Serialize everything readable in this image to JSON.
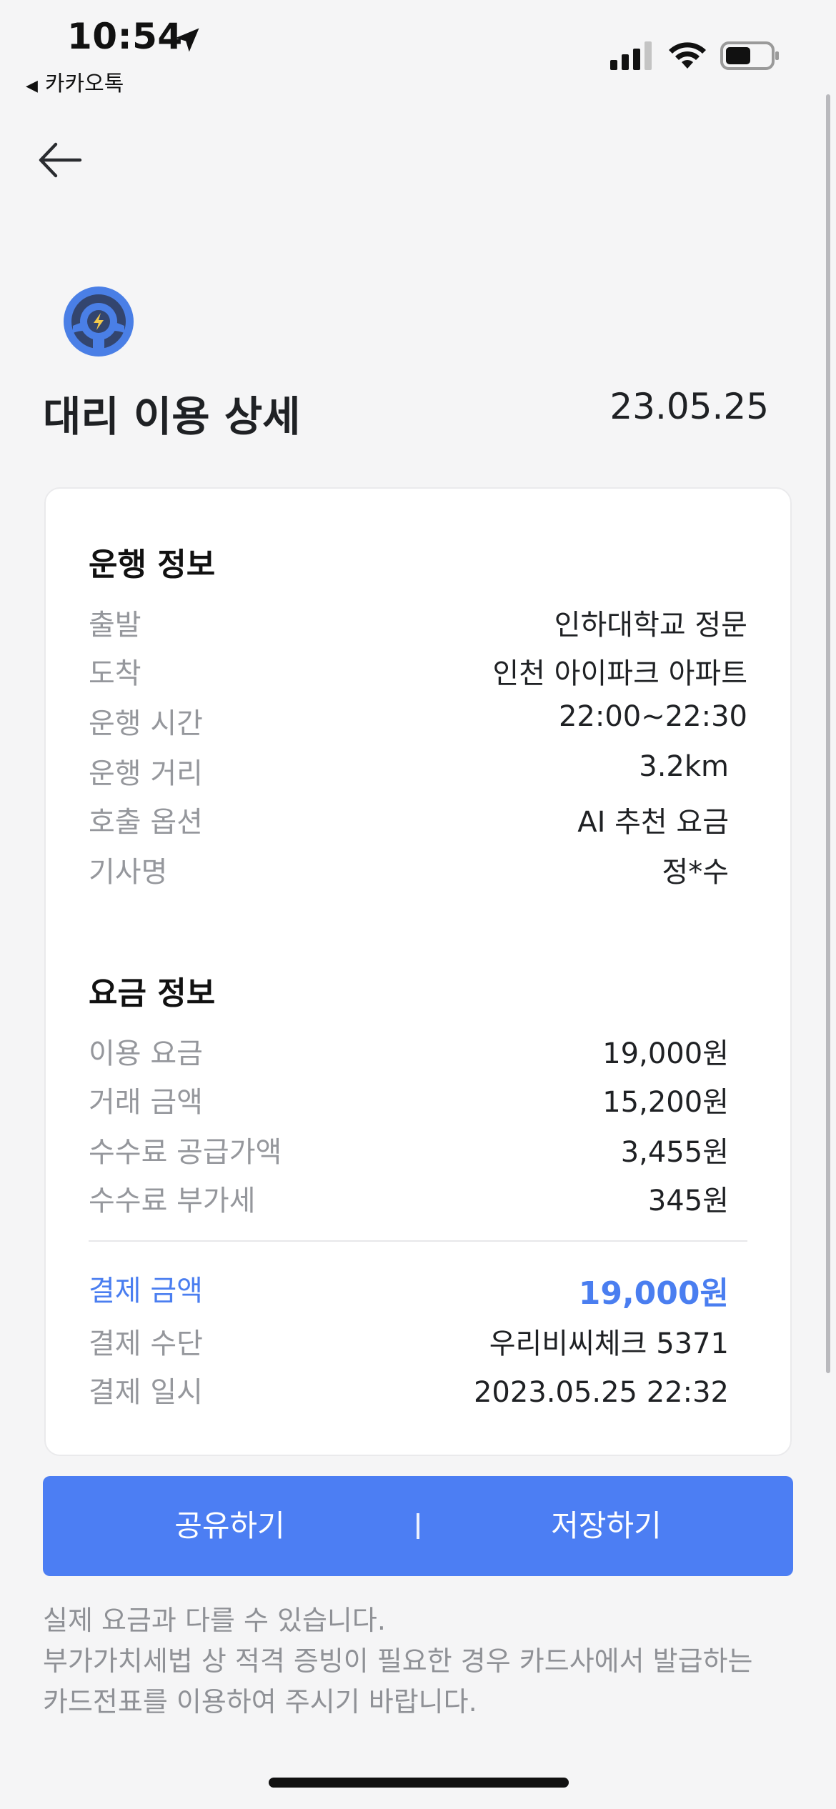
{
  "status_bar": {
    "time": "10:54",
    "back_app_label": "카카오톡"
  },
  "header": {
    "title": "대리 이용 상세",
    "date": "23.05.25"
  },
  "drive_info": {
    "title": "운행 정보",
    "rows": [
      {
        "label": "출발",
        "value": "인하대학교 정문"
      },
      {
        "label": "도착",
        "value": "인천 아이파크 아파트"
      },
      {
        "label": "운행 시간",
        "value": "22:00~22:30"
      },
      {
        "label": "운행 거리",
        "value": "3.2km"
      },
      {
        "label": "호출 옵션",
        "value": "AI 추천 요금"
      },
      {
        "label": "기사명",
        "value": "정*수"
      }
    ]
  },
  "fare_info": {
    "title": "요금 정보",
    "rows": [
      {
        "label": "이용 요금",
        "value": "19,000원"
      },
      {
        "label": "거래 금액",
        "value": "15,200원"
      },
      {
        "label": "수수료 공급가액",
        "value": "3,455원"
      },
      {
        "label": "수수료 부가세",
        "value": "345원"
      }
    ],
    "payment_amount": {
      "label": "결제 금액",
      "value": "19,000원"
    },
    "payment_method": {
      "label": "결제 수단",
      "value": "우리비씨체크 5371"
    },
    "payment_datetime": {
      "label": "결제 일시",
      "value": "2023.05.25 22:32"
    }
  },
  "actions": {
    "share_label": "공유하기",
    "save_label": "저장하기",
    "separator": "|"
  },
  "notice": {
    "line1": "실제 요금과 다를 수 있습니다.",
    "line2": "부가가치세법 상 적격 증빙이 필요한 경우 카드사에서 발급하는",
    "line3": "카드전표를 이용하여 주시기 바랍니다."
  },
  "colors": {
    "accent": "#4c7ef3",
    "payment_text": "#4a7ef0",
    "label_gray": "#95979c",
    "background": "#f5f5f6"
  },
  "icons": [
    "location-arrow-icon",
    "cellular-signal-icon",
    "wifi-icon",
    "battery-icon",
    "back-arrow-icon",
    "steering-wheel-icon"
  ]
}
